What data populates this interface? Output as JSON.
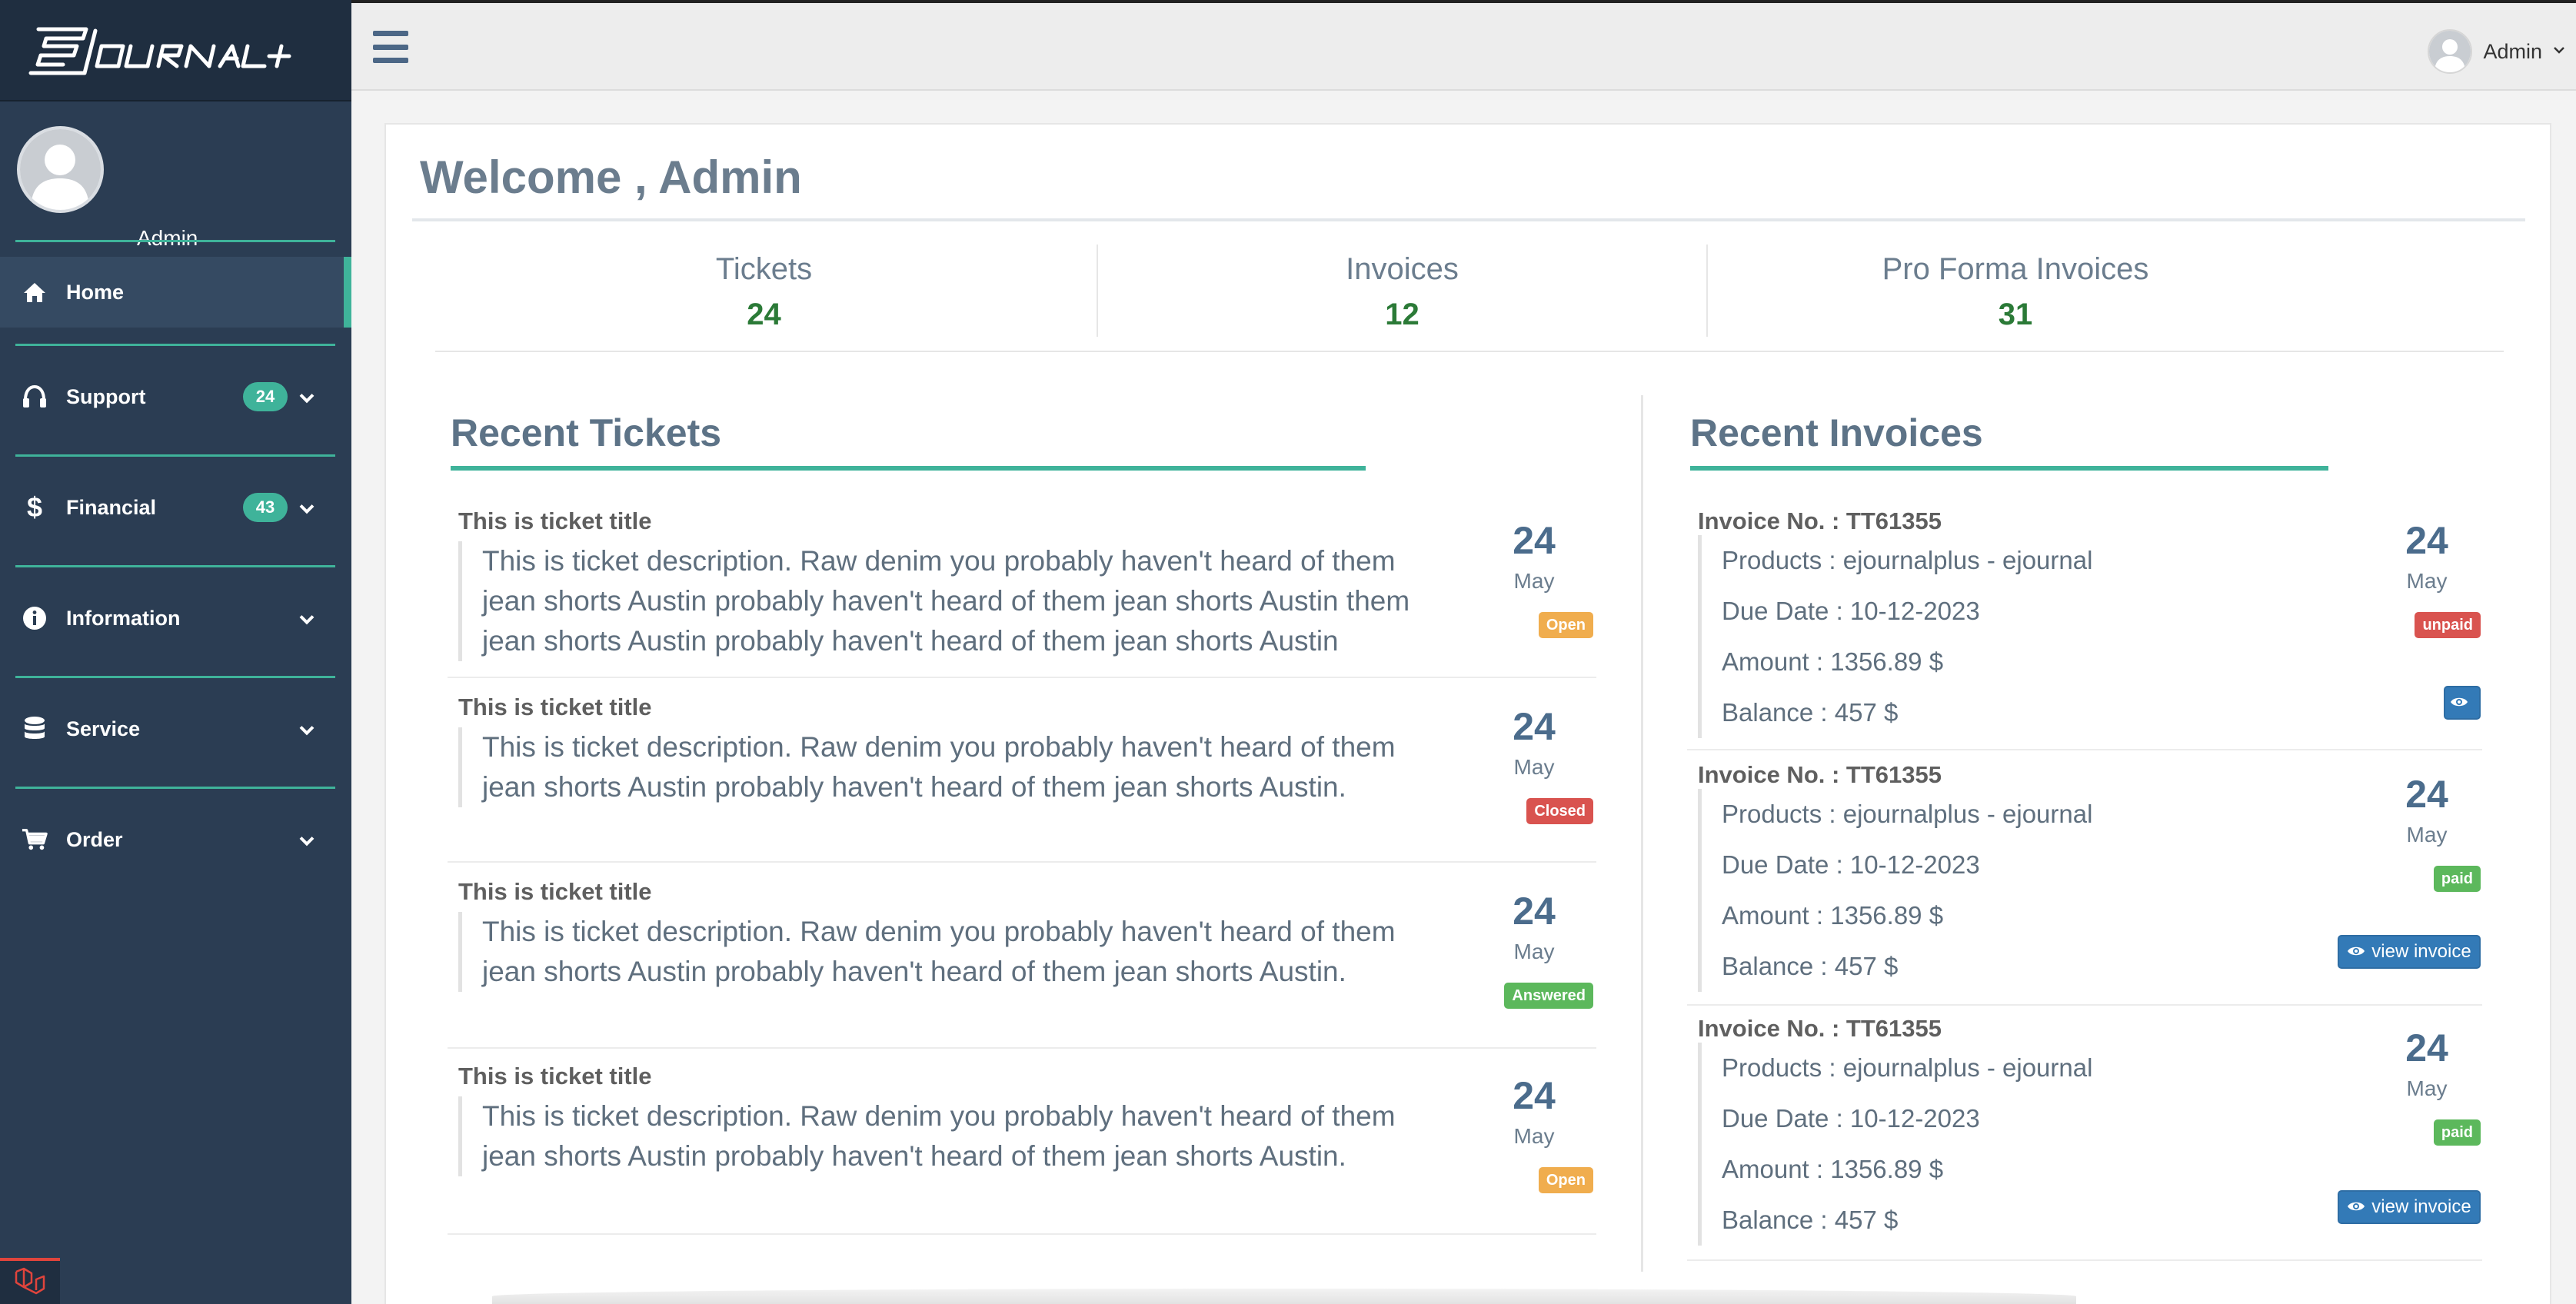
{
  "brand": {
    "logo_text": "EJOURNAL+",
    "accent": "#3fb39a",
    "sidebar_bg": "#2b3d53"
  },
  "sidebar": {
    "user_name": "Admin",
    "items": [
      {
        "label": "Home",
        "icon": "home-icon",
        "active": true
      },
      {
        "label": "Support",
        "icon": "headphones-icon",
        "badge": "24"
      },
      {
        "label": "Financial",
        "icon": "dollar-icon",
        "badge": "43"
      },
      {
        "label": "Information",
        "icon": "info-icon"
      },
      {
        "label": "Service",
        "icon": "database-icon"
      },
      {
        "label": "Order",
        "icon": "cart-icon"
      }
    ]
  },
  "topbar": {
    "user_name": "Admin"
  },
  "welcome": "Welcome , Admin",
  "stats": [
    {
      "label": "Tickets",
      "value": "24"
    },
    {
      "label": "Invoices",
      "value": "12"
    },
    {
      "label": "Pro Forma Invoices",
      "value": "31"
    }
  ],
  "recent_tickets": {
    "title": "Recent Tickets",
    "items": [
      {
        "title": "This is ticket title",
        "description": "This is ticket description. Raw denim you probably haven't heard of them jean shorts Austin probably haven't heard of them jean shorts Austin them jean shorts Austin probably haven't heard of them jean shorts Austin",
        "day": "24",
        "month": "May",
        "status": "Open",
        "status_color": "#f0ad4e"
      },
      {
        "title": "This is ticket title",
        "description": "This is ticket description. Raw denim you probably haven't heard of them jean shorts Austin probably haven't heard of them jean shorts Austin.",
        "day": "24",
        "month": "May",
        "status": "Closed",
        "status_color": "#d9534f"
      },
      {
        "title": "This is ticket title",
        "description": "This is ticket description. Raw denim you probably haven't heard of them jean shorts Austin probably haven't heard of them jean shorts Austin.",
        "day": "24",
        "month": "May",
        "status": "Answered",
        "status_color": "#5cb85c"
      },
      {
        "title": "This is ticket title",
        "description": "This is ticket description. Raw denim you probably haven't heard of them jean shorts Austin probably haven't heard of them jean shorts Austin.",
        "day": "24",
        "month": "May",
        "status": "Open",
        "status_color": "#f0ad4e"
      }
    ]
  },
  "recent_invoices": {
    "title": "Recent Invoices",
    "items": [
      {
        "number": "Invoice No. : TT61355",
        "products": "Products : ejournalplus - ejournal",
        "due_date": "Due Date : 10-12-2023",
        "amount": "Amount : 1356.89 $",
        "balance": "Balance : 457 $",
        "day": "24",
        "month": "May",
        "status": "unpaid",
        "status_color": "#d9534f",
        "action": ""
      },
      {
        "number": "Invoice No. : TT61355",
        "products": "Products : ejournalplus - ejournal",
        "due_date": "Due Date : 10-12-2023",
        "amount": "Amount : 1356.89 $",
        "balance": "Balance : 457 $",
        "day": "24",
        "month": "May",
        "status": "paid",
        "status_color": "#5cb85c",
        "action": "view invoice"
      },
      {
        "number": "Invoice No. : TT61355",
        "products": "Products : ejournalplus - ejournal",
        "due_date": "Due Date : 10-12-2023",
        "amount": "Amount : 1356.89 $",
        "balance": "Balance : 457 $",
        "day": "24",
        "month": "May",
        "status": "paid",
        "status_color": "#5cb85c",
        "action": "view invoice"
      }
    ]
  }
}
